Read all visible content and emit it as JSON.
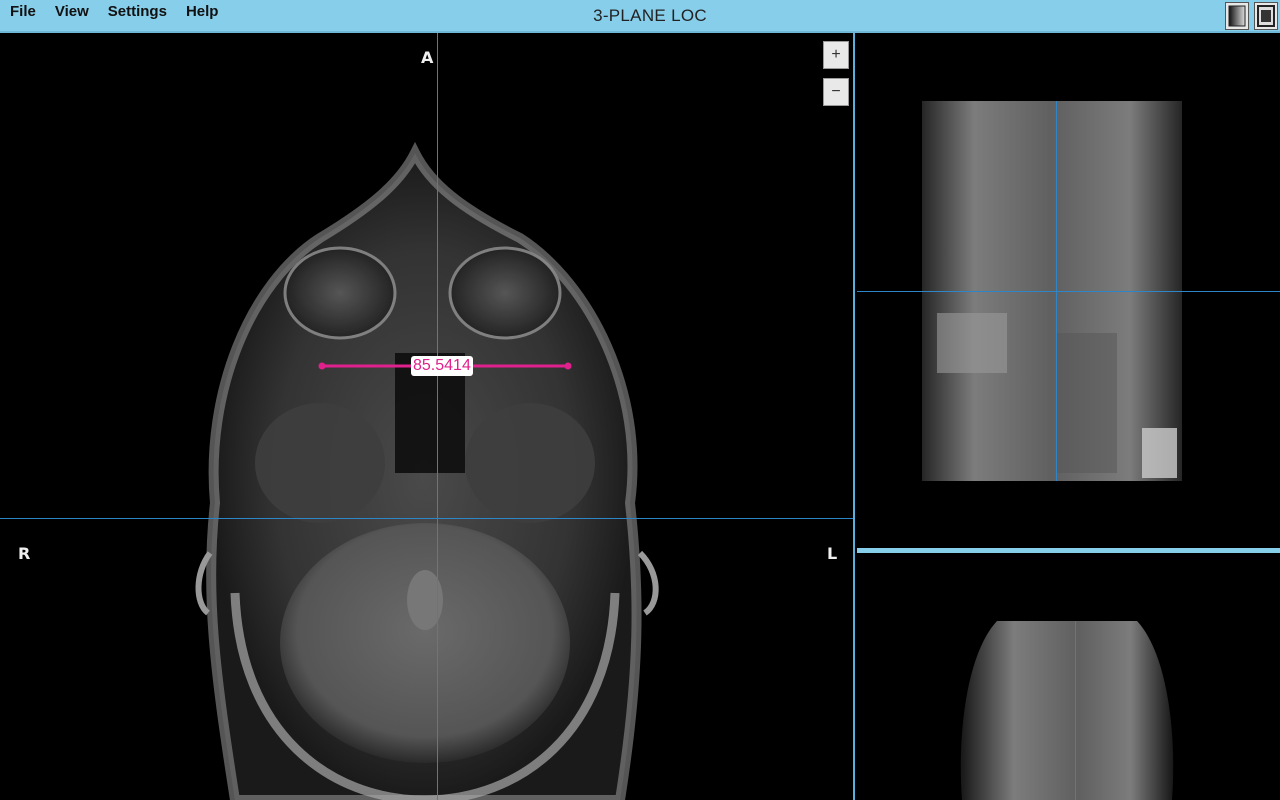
{
  "menu": {
    "items": [
      "File",
      "View",
      "Settings",
      "Help"
    ]
  },
  "app": {
    "title": "3-PLANE LOC"
  },
  "main_view": {
    "orientation": {
      "top": "A",
      "right": "L",
      "left": "R"
    },
    "zoom_in_label": "+",
    "zoom_out_label": "−",
    "measurement": {
      "value": "85.5414",
      "color": "#e0208c"
    }
  },
  "colors": {
    "toolbar": "#87ceeb",
    "crosshair": "#2e86c8",
    "measurement": "#e0208c"
  },
  "icons": {
    "window_button_1": "window-layout-icon",
    "window_button_2": "window-restore-icon"
  }
}
